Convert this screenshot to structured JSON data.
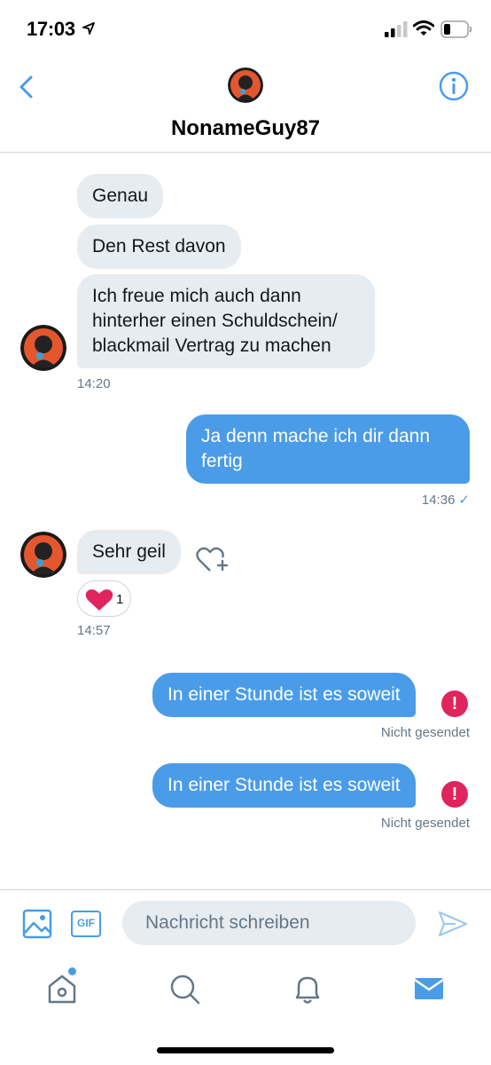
{
  "status_bar": {
    "time": "17:03"
  },
  "header": {
    "contact_name": "NonameGuy87"
  },
  "messages": [
    {
      "text": "Genau"
    },
    {
      "text": "Den Rest davon"
    },
    {
      "text": "Ich freue mich auch dann hinterher einen Schuldschein/ blackmail Vertrag zu machen"
    },
    {
      "text": "Ja denn mache ich dir dann fertig"
    },
    {
      "text": "Sehr geil"
    },
    {
      "text": "In einer Stunde ist es soweit"
    },
    {
      "text": "In einer Stunde ist es soweit"
    }
  ],
  "times": {
    "t1": "14:20",
    "t2": "14:36",
    "t3": "14:57"
  },
  "check_mark": "✓",
  "reaction": {
    "count": "1"
  },
  "error_mark": "!",
  "failed_status": "Nicht gesendet",
  "composer": {
    "gif_label": "GIF",
    "placeholder": "Nachricht schreiben"
  },
  "colors": {
    "accent": "#4a9ce8",
    "incoming_bubble": "#e6ecf0",
    "error": "#e0245e",
    "heart": "#e0245e"
  },
  "icons": [
    "back-icon",
    "info-icon",
    "image-icon",
    "gif-icon",
    "send-icon",
    "home-icon",
    "search-icon",
    "bell-icon",
    "mail-icon",
    "heart-add-icon",
    "heart-icon",
    "error-icon"
  ]
}
